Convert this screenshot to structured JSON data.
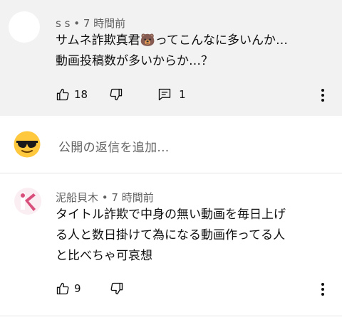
{
  "comment1": {
    "author": "s s",
    "time": "7 時間前",
    "line1": "サムネ詐欺真君🐻ってこんなに多いんか…",
    "line2": "動画投稿数が多いからか…？",
    "likes": "18",
    "replies": "1"
  },
  "reply_box": {
    "placeholder": "公開の返信を追加..."
  },
  "comment2": {
    "author": "泥船貝木",
    "time": "7 時間前",
    "line1": "タイトル詐欺で中身の無い動画を毎日上げ",
    "line2": "る人と数日掛けて為になる動画作ってる人",
    "line3": "と比べちゃ可哀想",
    "likes": "9"
  },
  "colors": {
    "highlight_bg": "#f2f2f2",
    "meta_text": "#606060",
    "text": "#0f0f0f"
  }
}
